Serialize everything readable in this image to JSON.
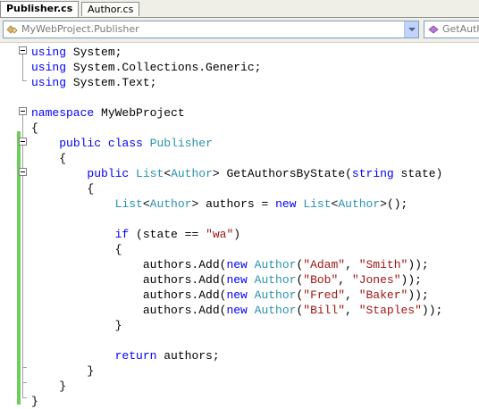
{
  "tabs": [
    {
      "label": "Publisher.cs",
      "active": true
    },
    {
      "label": "Author.cs",
      "active": false
    }
  ],
  "navbar": {
    "type_combo_value": "MyWebProject.Publisher",
    "member_combo_value": "GetAuthorsByState"
  },
  "code": [
    [
      {
        "t": "using",
        "c": "kw"
      },
      {
        "t": " System;"
      }
    ],
    [
      {
        "t": "using",
        "c": "kw"
      },
      {
        "t": " System.Collections.Generic;"
      }
    ],
    [
      {
        "t": "using",
        "c": "kw"
      },
      {
        "t": " System.Text;"
      }
    ],
    [],
    [
      {
        "t": "namespace",
        "c": "kw"
      },
      {
        "t": " MyWebProject"
      }
    ],
    [
      {
        "t": "{"
      }
    ],
    [
      {
        "t": "    "
      },
      {
        "t": "public",
        "c": "kw"
      },
      {
        "t": " "
      },
      {
        "t": "class",
        "c": "kw"
      },
      {
        "t": " "
      },
      {
        "t": "Publisher",
        "c": "ty"
      }
    ],
    [
      {
        "t": "    {"
      }
    ],
    [
      {
        "t": "        "
      },
      {
        "t": "public",
        "c": "kw"
      },
      {
        "t": " "
      },
      {
        "t": "List",
        "c": "ty"
      },
      {
        "t": "<"
      },
      {
        "t": "Author",
        "c": "ty"
      },
      {
        "t": "> GetAuthorsByState("
      },
      {
        "t": "string",
        "c": "kw"
      },
      {
        "t": " state)"
      }
    ],
    [
      {
        "t": "        {"
      }
    ],
    [
      {
        "t": "            "
      },
      {
        "t": "List",
        "c": "ty"
      },
      {
        "t": "<"
      },
      {
        "t": "Author",
        "c": "ty"
      },
      {
        "t": "> authors = "
      },
      {
        "t": "new",
        "c": "kw"
      },
      {
        "t": " "
      },
      {
        "t": "List",
        "c": "ty"
      },
      {
        "t": "<"
      },
      {
        "t": "Author",
        "c": "ty"
      },
      {
        "t": ">();"
      }
    ],
    [],
    [
      {
        "t": "            "
      },
      {
        "t": "if",
        "c": "kw"
      },
      {
        "t": " (state == "
      },
      {
        "t": "\"wa\"",
        "c": "st"
      },
      {
        "t": ")"
      }
    ],
    [
      {
        "t": "            {"
      }
    ],
    [
      {
        "t": "                authors.Add("
      },
      {
        "t": "new",
        "c": "kw"
      },
      {
        "t": " "
      },
      {
        "t": "Author",
        "c": "ty"
      },
      {
        "t": "("
      },
      {
        "t": "\"Adam\"",
        "c": "st"
      },
      {
        "t": ", "
      },
      {
        "t": "\"Smith\"",
        "c": "st"
      },
      {
        "t": "));"
      }
    ],
    [
      {
        "t": "                authors.Add("
      },
      {
        "t": "new",
        "c": "kw"
      },
      {
        "t": " "
      },
      {
        "t": "Author",
        "c": "ty"
      },
      {
        "t": "("
      },
      {
        "t": "\"Bob\"",
        "c": "st"
      },
      {
        "t": ", "
      },
      {
        "t": "\"Jones\"",
        "c": "st"
      },
      {
        "t": "));"
      }
    ],
    [
      {
        "t": "                authors.Add("
      },
      {
        "t": "new",
        "c": "kw"
      },
      {
        "t": " "
      },
      {
        "t": "Author",
        "c": "ty"
      },
      {
        "t": "("
      },
      {
        "t": "\"Fred\"",
        "c": "st"
      },
      {
        "t": ", "
      },
      {
        "t": "\"Baker\"",
        "c": "st"
      },
      {
        "t": "));"
      }
    ],
    [
      {
        "t": "                authors.Add("
      },
      {
        "t": "new",
        "c": "kw"
      },
      {
        "t": " "
      },
      {
        "t": "Author",
        "c": "ty"
      },
      {
        "t": "("
      },
      {
        "t": "\"Bill\"",
        "c": "st"
      },
      {
        "t": ", "
      },
      {
        "t": "\"Staples\"",
        "c": "st"
      },
      {
        "t": "));"
      }
    ],
    [
      {
        "t": "            }"
      }
    ],
    [],
    [
      {
        "t": "            "
      },
      {
        "t": "return",
        "c": "kw"
      },
      {
        "t": " authors;"
      }
    ],
    [
      {
        "t": "        }"
      }
    ],
    [
      {
        "t": "    }"
      }
    ],
    [
      {
        "t": "}"
      }
    ]
  ],
  "colors": {
    "keyword": "#0000ff",
    "type": "#2b91af",
    "string": "#a31515",
    "changed_marker": "#6cce5b"
  }
}
